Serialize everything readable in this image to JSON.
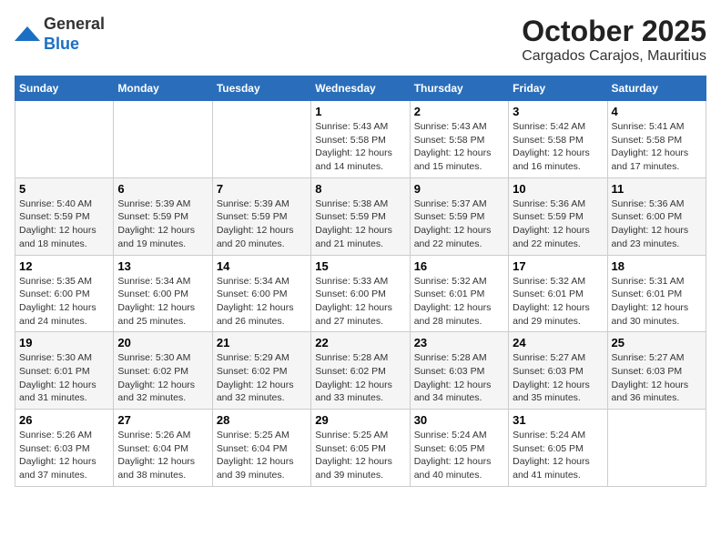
{
  "header": {
    "logo_line1": "General",
    "logo_line2": "Blue",
    "month_title": "October 2025",
    "location": "Cargados Carajos, Mauritius"
  },
  "days_of_week": [
    "Sunday",
    "Monday",
    "Tuesday",
    "Wednesday",
    "Thursday",
    "Friday",
    "Saturday"
  ],
  "weeks": [
    [
      {
        "day": "",
        "info": ""
      },
      {
        "day": "",
        "info": ""
      },
      {
        "day": "",
        "info": ""
      },
      {
        "day": "1",
        "info": "Sunrise: 5:43 AM\nSunset: 5:58 PM\nDaylight: 12 hours\nand 14 minutes."
      },
      {
        "day": "2",
        "info": "Sunrise: 5:43 AM\nSunset: 5:58 PM\nDaylight: 12 hours\nand 15 minutes."
      },
      {
        "day": "3",
        "info": "Sunrise: 5:42 AM\nSunset: 5:58 PM\nDaylight: 12 hours\nand 16 minutes."
      },
      {
        "day": "4",
        "info": "Sunrise: 5:41 AM\nSunset: 5:58 PM\nDaylight: 12 hours\nand 17 minutes."
      }
    ],
    [
      {
        "day": "5",
        "info": "Sunrise: 5:40 AM\nSunset: 5:59 PM\nDaylight: 12 hours\nand 18 minutes."
      },
      {
        "day": "6",
        "info": "Sunrise: 5:39 AM\nSunset: 5:59 PM\nDaylight: 12 hours\nand 19 minutes."
      },
      {
        "day": "7",
        "info": "Sunrise: 5:39 AM\nSunset: 5:59 PM\nDaylight: 12 hours\nand 20 minutes."
      },
      {
        "day": "8",
        "info": "Sunrise: 5:38 AM\nSunset: 5:59 PM\nDaylight: 12 hours\nand 21 minutes."
      },
      {
        "day": "9",
        "info": "Sunrise: 5:37 AM\nSunset: 5:59 PM\nDaylight: 12 hours\nand 22 minutes."
      },
      {
        "day": "10",
        "info": "Sunrise: 5:36 AM\nSunset: 5:59 PM\nDaylight: 12 hours\nand 22 minutes."
      },
      {
        "day": "11",
        "info": "Sunrise: 5:36 AM\nSunset: 6:00 PM\nDaylight: 12 hours\nand 23 minutes."
      }
    ],
    [
      {
        "day": "12",
        "info": "Sunrise: 5:35 AM\nSunset: 6:00 PM\nDaylight: 12 hours\nand 24 minutes."
      },
      {
        "day": "13",
        "info": "Sunrise: 5:34 AM\nSunset: 6:00 PM\nDaylight: 12 hours\nand 25 minutes."
      },
      {
        "day": "14",
        "info": "Sunrise: 5:34 AM\nSunset: 6:00 PM\nDaylight: 12 hours\nand 26 minutes."
      },
      {
        "day": "15",
        "info": "Sunrise: 5:33 AM\nSunset: 6:00 PM\nDaylight: 12 hours\nand 27 minutes."
      },
      {
        "day": "16",
        "info": "Sunrise: 5:32 AM\nSunset: 6:01 PM\nDaylight: 12 hours\nand 28 minutes."
      },
      {
        "day": "17",
        "info": "Sunrise: 5:32 AM\nSunset: 6:01 PM\nDaylight: 12 hours\nand 29 minutes."
      },
      {
        "day": "18",
        "info": "Sunrise: 5:31 AM\nSunset: 6:01 PM\nDaylight: 12 hours\nand 30 minutes."
      }
    ],
    [
      {
        "day": "19",
        "info": "Sunrise: 5:30 AM\nSunset: 6:01 PM\nDaylight: 12 hours\nand 31 minutes."
      },
      {
        "day": "20",
        "info": "Sunrise: 5:30 AM\nSunset: 6:02 PM\nDaylight: 12 hours\nand 32 minutes."
      },
      {
        "day": "21",
        "info": "Sunrise: 5:29 AM\nSunset: 6:02 PM\nDaylight: 12 hours\nand 32 minutes."
      },
      {
        "day": "22",
        "info": "Sunrise: 5:28 AM\nSunset: 6:02 PM\nDaylight: 12 hours\nand 33 minutes."
      },
      {
        "day": "23",
        "info": "Sunrise: 5:28 AM\nSunset: 6:03 PM\nDaylight: 12 hours\nand 34 minutes."
      },
      {
        "day": "24",
        "info": "Sunrise: 5:27 AM\nSunset: 6:03 PM\nDaylight: 12 hours\nand 35 minutes."
      },
      {
        "day": "25",
        "info": "Sunrise: 5:27 AM\nSunset: 6:03 PM\nDaylight: 12 hours\nand 36 minutes."
      }
    ],
    [
      {
        "day": "26",
        "info": "Sunrise: 5:26 AM\nSunset: 6:03 PM\nDaylight: 12 hours\nand 37 minutes."
      },
      {
        "day": "27",
        "info": "Sunrise: 5:26 AM\nSunset: 6:04 PM\nDaylight: 12 hours\nand 38 minutes."
      },
      {
        "day": "28",
        "info": "Sunrise: 5:25 AM\nSunset: 6:04 PM\nDaylight: 12 hours\nand 39 minutes."
      },
      {
        "day": "29",
        "info": "Sunrise: 5:25 AM\nSunset: 6:05 PM\nDaylight: 12 hours\nand 39 minutes."
      },
      {
        "day": "30",
        "info": "Sunrise: 5:24 AM\nSunset: 6:05 PM\nDaylight: 12 hours\nand 40 minutes."
      },
      {
        "day": "31",
        "info": "Sunrise: 5:24 AM\nSunset: 6:05 PM\nDaylight: 12 hours\nand 41 minutes."
      },
      {
        "day": "",
        "info": ""
      }
    ]
  ]
}
